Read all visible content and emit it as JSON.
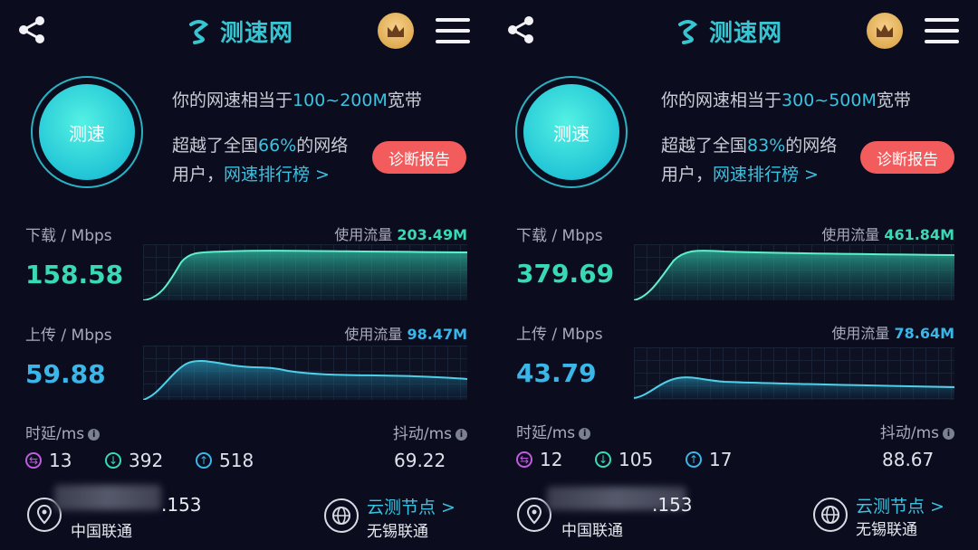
{
  "header": {
    "brand": "测速网",
    "share_icon": "share-icon",
    "crown_icon": "crown-icon",
    "menu_icon": "menu-icon"
  },
  "colors": {
    "accent": "#39c3e0",
    "download": "#38d9b4",
    "upload": "#3ab6e8",
    "diag_button": "#f25c5c",
    "background": "#0b0d1f"
  },
  "panels": [
    {
      "speed_button": "测速",
      "equiv_prefix": "你的网速相当于",
      "equiv_value": "100~200M",
      "equiv_suffix": "宽带",
      "beat_prefix": "超越了全国",
      "beat_percent": "66%",
      "beat_suffix": "的网络",
      "users_prefix": "用户，",
      "ranking_link": "网速排行榜 >",
      "diagnose_button": "诊断报告",
      "download": {
        "label": "下载 / Mbps",
        "value": "158.58",
        "usage_label": "使用流量",
        "usage_value": "203.49M"
      },
      "upload": {
        "label": "上传 / Mbps",
        "value": "59.88",
        "usage_label": "使用流量",
        "usage_value": "98.47M"
      },
      "latency": {
        "label": "时延/ms",
        "idle": "13",
        "down": "392",
        "up": "518"
      },
      "jitter": {
        "label": "抖动/ms",
        "value": "69.22"
      },
      "ip_suffix": ".153",
      "isp": "中国联通",
      "cloud_node": "云测节点 >",
      "node_name": "无锡联通"
    },
    {
      "speed_button": "测速",
      "equiv_prefix": "你的网速相当于",
      "equiv_value": "300~500M",
      "equiv_suffix": "宽带",
      "beat_prefix": "超越了全国",
      "beat_percent": "83%",
      "beat_suffix": "的网络",
      "users_prefix": "用户，",
      "ranking_link": "网速排行榜 >",
      "diagnose_button": "诊断报告",
      "download": {
        "label": "下载 / Mbps",
        "value": "379.69",
        "usage_label": "使用流量",
        "usage_value": "461.84M"
      },
      "upload": {
        "label": "上传 / Mbps",
        "value": "43.79",
        "usage_label": "使用流量",
        "usage_value": "78.64M"
      },
      "latency": {
        "label": "时延/ms",
        "idle": "12",
        "down": "105",
        "up": "17"
      },
      "jitter": {
        "label": "抖动/ms",
        "value": "88.67"
      },
      "ip_suffix": ".153",
      "isp": "中国联通",
      "cloud_node": "云测节点 >",
      "node_name": "无锡联通"
    }
  ]
}
